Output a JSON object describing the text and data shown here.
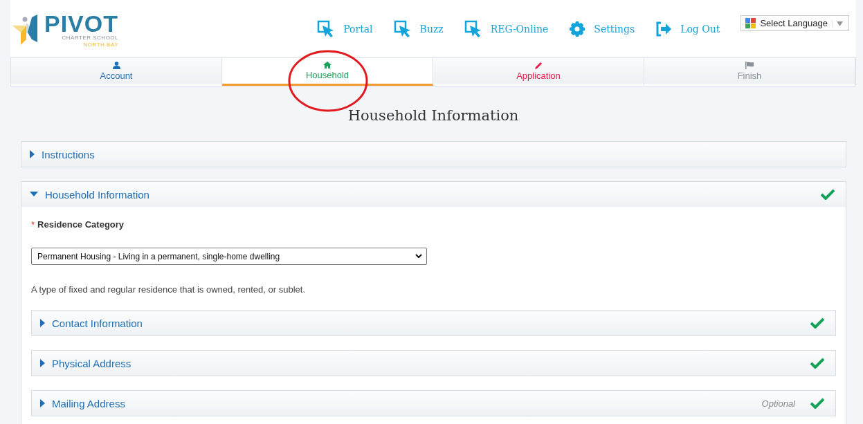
{
  "logo": {
    "name": "PIVOT",
    "line_1": "CHARTER SCHOOL",
    "line_2": "NORTH BAY"
  },
  "nav": [
    {
      "label": "Portal",
      "kind": "pointer"
    },
    {
      "label": "Buzz",
      "kind": "pointer"
    },
    {
      "label": "REG-Online",
      "kind": "pointer"
    },
    {
      "label": "Settings",
      "kind": "gear"
    },
    {
      "label": "Log Out",
      "kind": "logout"
    }
  ],
  "language": {
    "label": "Select Language"
  },
  "tabs": [
    {
      "label": "Account",
      "kind": "user",
      "color": "#1e6fb8",
      "selected": false,
      "circled": false
    },
    {
      "label": "Household",
      "kind": "home",
      "color": "#1aa05a",
      "selected": true,
      "circled": true
    },
    {
      "label": "Application",
      "kind": "pencil",
      "color": "#e8194a",
      "selected": false,
      "circled": false
    },
    {
      "label": "Finish",
      "kind": "flag",
      "color": "#8a9099",
      "selected": false,
      "circled": false
    }
  ],
  "title": "Household Information",
  "sections": [
    {
      "title": "Instructions",
      "expanded": false,
      "complete": false
    },
    {
      "title": "Household Information",
      "expanded": true,
      "complete": true,
      "field": {
        "label": "Residence Category",
        "required_mark": "*",
        "value": "Permanent Housing - Living in a permanent, single-home dwelling",
        "help": "A type of fixed and regular residence that is owned, rented, or sublet."
      },
      "subsections": [
        {
          "title": "Contact Information",
          "complete": true
        },
        {
          "title": "Physical Address",
          "complete": true
        },
        {
          "title": "Mailing Address",
          "note": "Optional",
          "complete": true
        }
      ]
    }
  ]
}
